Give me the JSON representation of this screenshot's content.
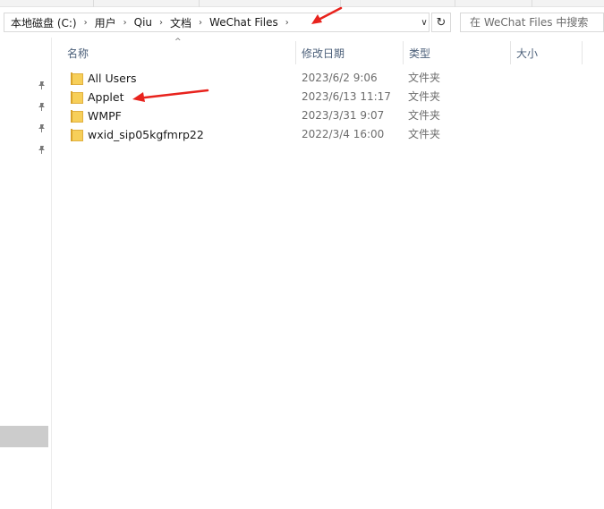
{
  "address_bar": {
    "crumbs": [
      "本地磁盘 (C:)",
      "用户",
      "Qiu",
      "文档",
      "WeChat Files"
    ],
    "separator": "›",
    "dropdown": "∨",
    "refresh": "↻"
  },
  "search": {
    "placeholder": "在 WeChat Files 中搜索"
  },
  "columns": {
    "name": "名称",
    "date": "修改日期",
    "type": "类型",
    "size": "大小",
    "sort_indicator": "^"
  },
  "nav_pane": {
    "pin_icon": "pin-icon"
  },
  "files": [
    {
      "name": "All Users",
      "date": "2023/6/2 9:06",
      "type": "文件夹",
      "icon": "folder-icon"
    },
    {
      "name": "Applet",
      "date": "2023/6/13 11:17",
      "type": "文件夹",
      "icon": "folder-icon"
    },
    {
      "name": "WMPF",
      "date": "2023/3/31 9:07",
      "type": "文件夹",
      "icon": "folder-icon"
    },
    {
      "name": "wxid_sip05kgfmrp22",
      "date": "2022/3/4 16:00",
      "type": "文件夹",
      "icon": "folder-icon"
    }
  ],
  "colors": {
    "annotation_arrow": "#e8231d",
    "folder": "#f7cf59",
    "header_text": "#4c607a",
    "nav_selected": "#cccccc"
  }
}
